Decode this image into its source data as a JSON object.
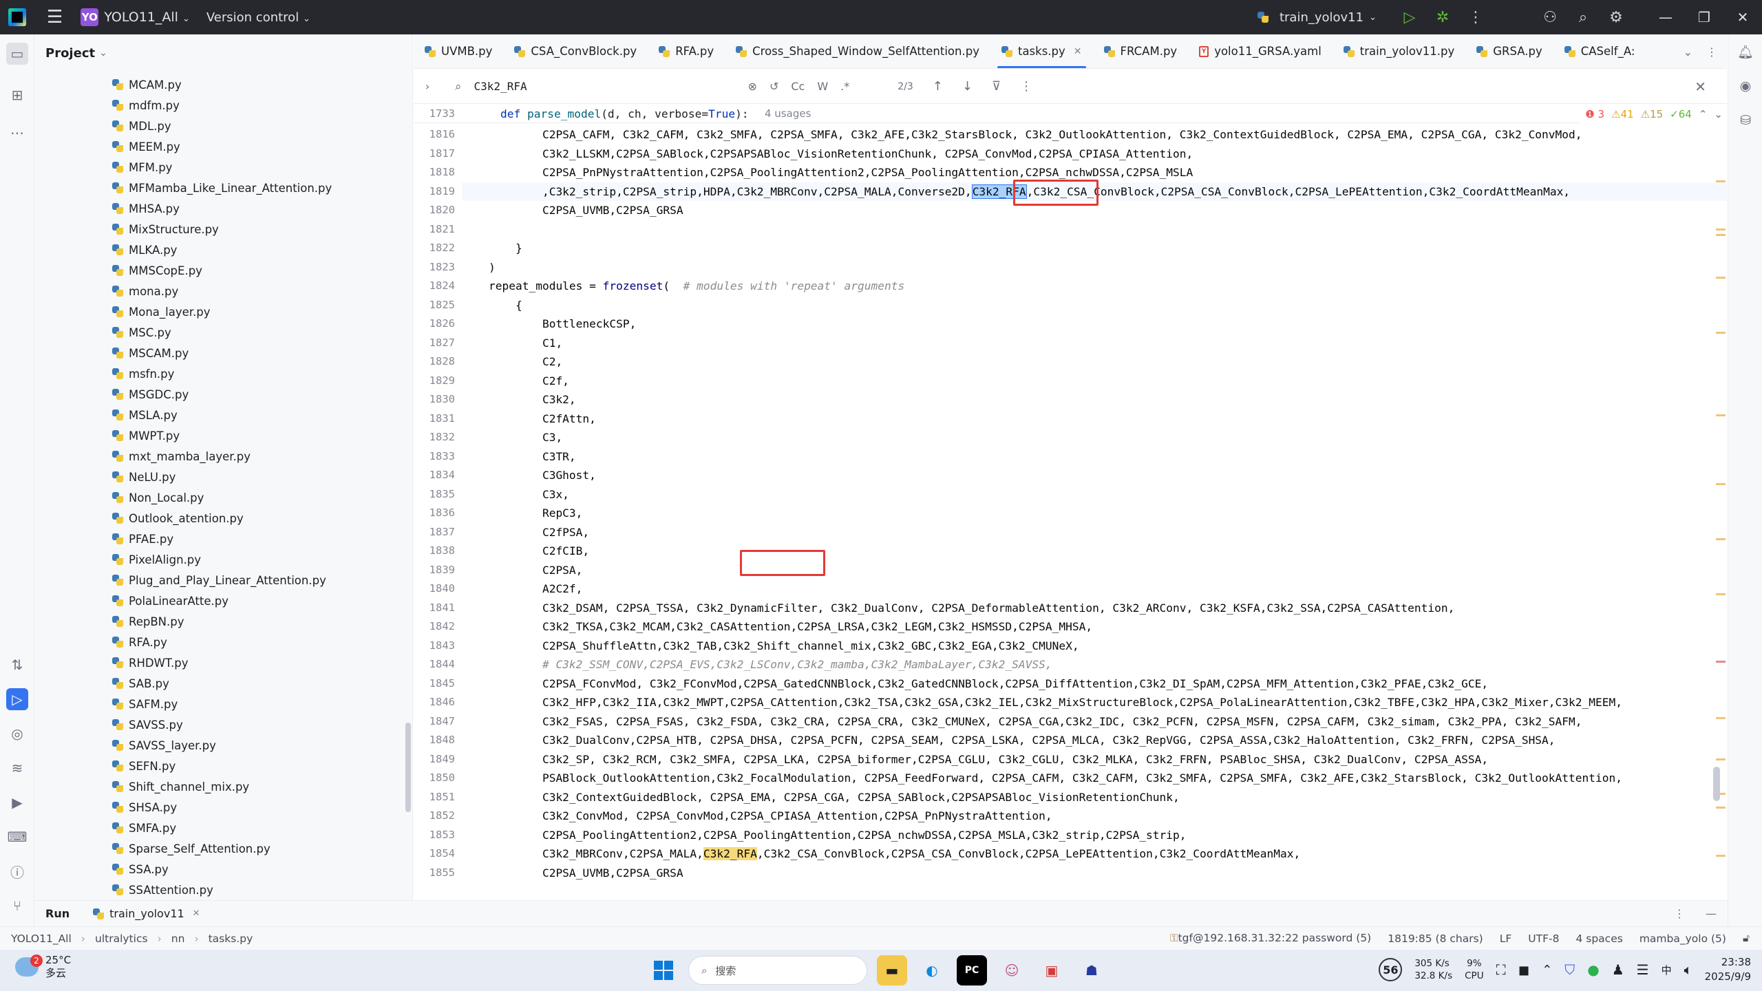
{
  "titlebar": {
    "project_badge": "YO",
    "project_name": "YOLO11_All",
    "vcs": "Version control",
    "run_config": "train_yolov11"
  },
  "project_panel": {
    "title": "Project",
    "files": [
      "MCAM.py",
      "mdfm.py",
      "MDL.py",
      "MEEM.py",
      "MFM.py",
      "MFMamba_Like_Linear_Attention.py",
      "MHSA.py",
      "MixStructure.py",
      "MLKA.py",
      "MMSCopE.py",
      "mona.py",
      "Mona_layer.py",
      "MSC.py",
      "MSCAM.py",
      "msfn.py",
      "MSGDC.py",
      "MSLA.py",
      "MWPT.py",
      "mxt_mamba_layer.py",
      "NeLU.py",
      "Non_Local.py",
      "Outlook_atention.py",
      "PFAE.py",
      "PixelAlign.py",
      "Plug_and_Play_Linear_Attention.py",
      "PolaLinearAtte.py",
      "RepBN.py",
      "RFA.py",
      "RHDWT.py",
      "SAB.py",
      "SAFM.py",
      "SAVSS.py",
      "SAVSS_layer.py",
      "SEFN.py",
      "Shift_channel_mix.py",
      "SHSA.py",
      "SMFA.py",
      "Sparse_Self_Attention.py",
      "SSA.py",
      "SSAttention.py"
    ]
  },
  "tabs": [
    {
      "label": "UVMB.py",
      "type": "py"
    },
    {
      "label": "CSA_ConvBlock.py",
      "type": "py"
    },
    {
      "label": "RFA.py",
      "type": "py"
    },
    {
      "label": "Cross_Shaped_Window_SelfAttention.py",
      "type": "py"
    },
    {
      "label": "tasks.py",
      "type": "py",
      "active": true
    },
    {
      "label": "FRCAM.py",
      "type": "py"
    },
    {
      "label": "yolo11_GRSA.yaml",
      "type": "yaml"
    },
    {
      "label": "train_yolov11.py",
      "type": "py"
    },
    {
      "label": "GRSA.py",
      "type": "py"
    },
    {
      "label": "CASelf_A:",
      "type": "py"
    }
  ],
  "find": {
    "query": "C3k2_RFA",
    "match_case": "Cc",
    "words": "W",
    "regex": ".*",
    "count": "2/3"
  },
  "inspection": {
    "errors": "3",
    "warnings": "41",
    "weak": "15",
    "ok": "64"
  },
  "sticky": {
    "line": "1733",
    "code": "def parse_model(d, ch, verbose=True):",
    "usages": "4 usages"
  },
  "code": {
    "line_numbers": [
      "1816",
      "1817",
      "1818",
      "1819",
      "1820",
      "1821",
      "1822",
      "1823",
      "1824",
      "1825",
      "1826",
      "1827",
      "1828",
      "1829",
      "1830",
      "1831",
      "1832",
      "1833",
      "1834",
      "1835",
      "1836",
      "1837",
      "1838",
      "1839",
      "1840",
      "1841",
      "1842",
      "1843",
      "1844",
      "1845",
      "1846",
      "1847",
      "1848",
      "1849",
      "1850",
      "1851",
      "1852",
      "1853",
      "1854",
      "1855"
    ],
    "lines": [
      "            C2PSA_CAFM, C3k2_CAFM, C3k2_SMFA, C2PSA_SMFA, C3k2_AFE,C3k2_StarsBlock, C3k2_OutlookAttention, C3k2_ContextGuidedBlock, C2PSA_EMA, C2PSA_CGA, C3k2_ConvMod,",
      "            C3k2_LLSKM,C2PSA_SABlock,C2PSAPSABloc_VisionRetentionChunk, C2PSA_ConvMod,C2PSA_CPIASA_Attention,",
      "            C2PSA_PnPNystraAttention,C2PSA_PoolingAttention2,C2PSA_PoolingAttention,C2PSA_nchwDSSA,C2PSA_MSLA",
      "            ,C3k2_strip,C2PSA_strip,HDPA,C3k2_MBRConv,C2PSA_MALA,Converse2D,C3k2_RFA,C3k2_CSA_ConvBlock,C2PSA_CSA_ConvBlock,C2PSA_LePEAttention,C3k2_CoordAttMeanMax,",
      "            C2PSA_UVMB,C2PSA_GRSA",
      "",
      "        }",
      "    )",
      "    repeat_modules = frozenset(  # modules with 'repeat' arguments",
      "        {",
      "            BottleneckCSP,",
      "            C1,",
      "            C2,",
      "            C2f,",
      "            C3k2,",
      "            C2fAttn,",
      "            C3,",
      "            C3TR,",
      "            C3Ghost,",
      "            C3x,",
      "            RepC3,",
      "            C2fPSA,",
      "            C2fCIB,",
      "            C2PSA,",
      "            A2C2f,",
      "            C3k2_DSAM, C2PSA_TSSA, C3k2_DynamicFilter, C3k2_DualConv, C2PSA_DeformableAttention, C3k2_ARConv, C3k2_KSFA,C3k2_SSA,C2PSA_CASAttention,",
      "            C3k2_TKSA,C3k2_MCAM,C3k2_CASAttention,C2PSA_LRSA,C3k2_LEGM,C3k2_HSMSSD,C2PSA_MHSA,",
      "            C2PSA_ShuffleAttn,C3k2_TAB,C3k2_Shift_channel_mix,C3k2_GBC,C3k2_EGA,C3k2_CMUNeX,",
      "            # C3k2_SSM_CONV,C2PSA_EVS,C3k2_LSConv,C3k2_mamba,C3k2_MambaLayer,C3k2_SAVSS,",
      "            C2PSA_FConvMod, C3k2_FConvMod,C2PSA_GatedCNNBlock,C3k2_GatedCNNBlock,C2PSA_DiffAttention,C3k2_DI_SpAM,C2PSA_MFM_Attention,C3k2_PFAE,C3k2_GCE,",
      "            C3k2_HFP,C3k2_IIA,C3k2_MWPT,C2PSA_CAttention,C3k2_TSA,C3k2_GSA,C3k2_IEL,C3k2_MixStructureBlock,C2PSA_PolaLinearAttention,C3k2_TBFE,C3k2_HPA,C3k2_Mixer,C3k2_MEEM,",
      "            C3k2_FSAS, C2PSA_FSAS, C3k2_FSDA, C3k2_CRA, C2PSA_CRA, C3k2_CMUNeX, C2PSA_CGA,C3k2_IDC, C3k2_PCFN, C2PSA_MSFN, C2PSA_CAFM, C3k2_simam, C3k2_PPA, C3k2_SAFM,",
      "            C3k2_DualConv,C2PSA_HTB, C2PSA_DHSA, C2PSA_PCFN, C2PSA_SEAM, C2PSA_LSKA, C2PSA_MLCA, C3k2_RepVGG, C2PSA_ASSA,C3k2_HaloAttention, C3k2_FRFN, C2PSA_SHSA,",
      "            C3k2_SP, C3k2_RCM, C3k2_SMFA, C2PSA_LKA, C2PSA_biformer,C2PSA_CGLU, C3k2_CGLU, C3k2_MLKA, C3k2_FRFN, PSABloc_SHSA, C3k2_DualConv, C2PSA_ASSA,",
      "            PSABlock_OutlookAttention,C3k2_FocalModulation, C2PSA_FeedForward, C2PSA_CAFM, C3k2_CAFM, C3k2_SMFA, C2PSA_SMFA, C3k2_AFE,C3k2_StarsBlock, C3k2_OutlookAttention,",
      "            C3k2_ContextGuidedBlock, C2PSA_EMA, C2PSA_CGA, C2PSA_SABlock,C2PSAPSABloc_VisionRetentionChunk,",
      "            C3k2_ConvMod, C2PSA_ConvMod,C2PSA_CPIASA_Attention,C2PSA_PnPNystraAttention,",
      "            C2PSA_PoolingAttention2,C2PSA_PoolingAttention,C2PSA_nchwDSSA,C2PSA_MSLA,C3k2_strip,C2PSA_strip,",
      "            C3k2_MBRConv,C2PSA_MALA,C3k2_RFA,C3k2_CSA_ConvBlock,C2PSA_CSA_ConvBlock,C2PSA_LePEAttention,C3k2_CoordAttMeanMax,",
      "            C2PSA_UVMB,C2PSA_GRSA"
    ]
  },
  "runbar": {
    "label": "Run",
    "tab": "train_yolov11"
  },
  "status": {
    "crumbs": [
      "YOLO11_All",
      "ultralytics",
      "nn",
      "tasks.py"
    ],
    "remote": "tgf@192.168.31.32:22 password (5)",
    "position": "1819:85 (8 chars)",
    "line_sep": "LF",
    "encoding": "UTF-8",
    "indent": "4 spaces",
    "interpreter": "mamba_yolo (5)"
  },
  "taskbar": {
    "weather_temp": "25°C",
    "weather_desc": "多云",
    "weather_badge": "2",
    "search_placeholder": "搜索",
    "badge": "56",
    "net_up": "305 K/s",
    "net_down": "32.8 K/s",
    "cpu_pct": "9%",
    "cpu_label": "CPU",
    "ime": "中",
    "time": "23:38",
    "date": "2025/9/9"
  }
}
